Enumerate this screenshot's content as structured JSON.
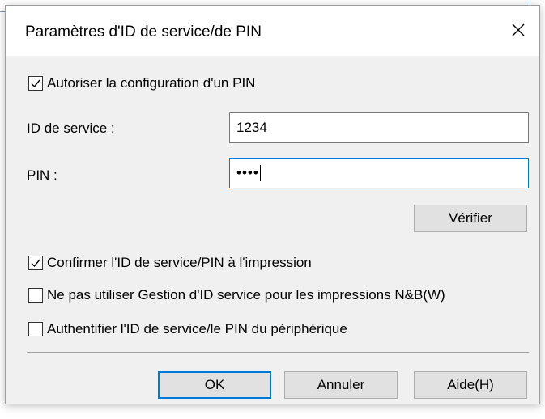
{
  "dialog": {
    "title": "Paramètres d'ID de service/de PIN",
    "close_icon": "close-icon"
  },
  "options": {
    "allow_pin": {
      "label": "Autoriser la configuration d'un PIN",
      "checked": true
    }
  },
  "fields": {
    "service_id": {
      "label": "ID de service :",
      "value": "1234"
    },
    "pin": {
      "label": "PIN :",
      "value": "••••"
    }
  },
  "buttons": {
    "verify": "Vérifier",
    "ok": "OK",
    "cancel": "Annuler",
    "help": "Aide(H)"
  },
  "checks": [
    {
      "label": "Confirmer l'ID de service/PIN à l'impression",
      "checked": true
    },
    {
      "label": "Ne pas utiliser Gestion d'ID service pour les impressions N&B(W)",
      "checked": false
    },
    {
      "label": "Authentifier l'ID de service/le PIN du périphérique",
      "checked": false
    }
  ],
  "colors": {
    "dialog_bg": "#f0f0f0",
    "accent": "#0078d7"
  }
}
